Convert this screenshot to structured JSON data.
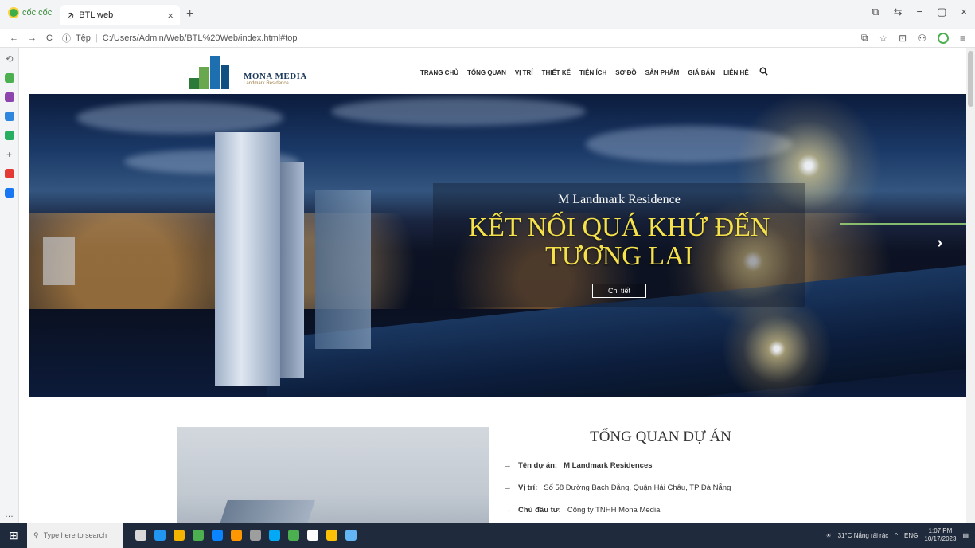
{
  "browser": {
    "brand": "cốc cốc",
    "tab_title": "BTL web",
    "tab_close": "×",
    "new_tab": "+",
    "win_controls": [
      "⧉",
      "⇆",
      "−",
      "▢",
      "×"
    ],
    "address": {
      "nav_buttons": [
        "←",
        "→",
        "C"
      ],
      "info": "ⓘ",
      "scheme_label": "Tệp",
      "url": "C:/Users/Admin/Web/BTL%20Web/index.html#top"
    },
    "address_right_icons": [
      "⧉",
      "☆",
      "⊡",
      "⚇"
    ],
    "sidebar_icons": [
      {
        "name": "history-icon",
        "glyph": "⟲",
        "color": "#777777"
      },
      {
        "name": "chat-icon",
        "glyph": "",
        "color": "#4caf50"
      },
      {
        "name": "messenger-icon",
        "glyph": "",
        "color": "#8e44ad"
      },
      {
        "name": "stats-icon",
        "glyph": "",
        "color": "#2e86de"
      },
      {
        "name": "game-icon",
        "glyph": "",
        "color": "#27ae60"
      },
      {
        "name": "add-icon",
        "glyph": "+",
        "color": "#777777"
      },
      {
        "name": "youtube-icon",
        "glyph": "",
        "color": "#e53935"
      },
      {
        "name": "facebook-icon",
        "glyph": "",
        "color": "#1877f2"
      }
    ],
    "sidebar_more": "…"
  },
  "site": {
    "logo": {
      "title": "MONA MEDIA",
      "subtitle": "Landmark Residence"
    },
    "nav": [
      "TRANG CHỦ",
      "TỔNG QUAN",
      "VỊ TRÍ",
      "THIẾT KẾ",
      "TIỆN ÍCH",
      "SƠ ĐỒ",
      "SẢN PHẨM",
      "GIÁ BÁN",
      "LIÊN HỆ"
    ],
    "search_icon": "⚲",
    "hero": {
      "subtitle": "M Landmark Residence",
      "title": "KẾT NỐI QUÁ KHỨ ĐẾN TƯƠNG LAI",
      "button": "Chi tiết",
      "next_arrow": "›"
    },
    "overview": {
      "title": "TỔNG QUAN DỰ ÁN",
      "items": [
        {
          "label": "Tên dự án:",
          "value": "M Landmark Residences",
          "bold_value": true
        },
        {
          "label": "Vị trí:",
          "value": "Số 58 Đường Bạch Đằng, Quận Hải Châu, TP Đà Nẵng",
          "bold_value": false
        },
        {
          "label": "Chủ đầu tư:",
          "value": "Công ty TNHH Mona Media",
          "bold_value": false
        }
      ],
      "arrow": "→"
    }
  },
  "taskbar": {
    "start_icon": "⊞",
    "search_placeholder": "Type here to search",
    "weather": "31°C Nắng rải rác",
    "lang": "ENG",
    "time": "1:07 PM",
    "date": "10/17/2023",
    "app_colors": [
      "#d9d9d9",
      "#2196f3",
      "#f4b400",
      "#4caf50",
      "#0a84ff",
      "#ff9800",
      "#9e9e9e",
      "#03a9f4",
      "#4caf50",
      "#ffffff",
      "#ffc107",
      "#64b5f6"
    ]
  }
}
